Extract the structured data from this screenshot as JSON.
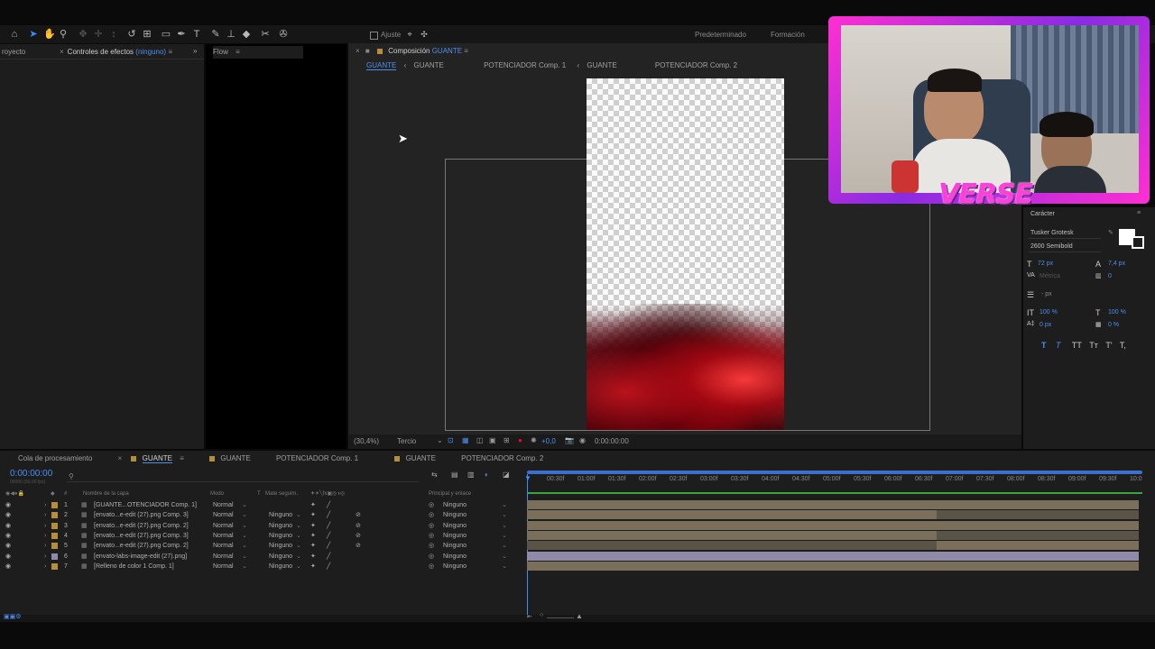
{
  "toolbar": {
    "adjust_label": "Ajuste",
    "workspaces": [
      "Predeterminado",
      "Formación"
    ]
  },
  "left_panel": {
    "project_tab": "royecto",
    "effects_tab": "Controles de efectos",
    "effects_sub": "(ninguno)",
    "flow_tab": "Flow"
  },
  "viewer": {
    "comp_label": "Composición",
    "comp_name": "GUANTE",
    "breadcrumbs": [
      "GUANTE",
      "GUANTE",
      "POTENCIADOR Comp. 1",
      "GUANTE",
      "POTENCIADOR Comp. 2"
    ],
    "zoom": "(30,4%)",
    "resolution": "Tercio",
    "exposure": "+0,0",
    "timecode": "0:00:00:00"
  },
  "char_panel": {
    "title": "Carácter",
    "font": "Tusker Grotesk",
    "style": "2600 Semibold",
    "size": "72 px",
    "leading": "7,4 px",
    "kerning": "Métrica",
    "tracking": "0",
    "stroke": "- px",
    "vscale": "100 %",
    "hscale": "100 %",
    "baseline": "0 px",
    "tsume": "0 %",
    "styles": [
      "T",
      "T",
      "TT",
      "Tт",
      "T'",
      "T,"
    ]
  },
  "webcam": {
    "overlay_text": "VERSE"
  },
  "timeline": {
    "tabs": [
      "Cola de procesamiento",
      "GUANTE",
      "GUANTE",
      "POTENCIADOR Comp. 1",
      "GUANTE",
      "POTENCIADOR Comp. 2"
    ],
    "timecode": "0:00:00:00",
    "timecode_sub": "00000 (60.00 fps)",
    "headers": {
      "num": "#",
      "name": "Nombre de la capa",
      "mode": "Modo",
      "t": "T",
      "matte": "Mate seguim.",
      "parent": "Principal y enlace"
    },
    "ruler": [
      "00:30f",
      "01:00f",
      "01:30f",
      "02:00f",
      "02:30f",
      "03:00f",
      "03:30f",
      "04:00f",
      "04:30f",
      "05:00f",
      "05:30f",
      "06:00f",
      "06:30f",
      "07:00f",
      "07:30f",
      "08:00f",
      "08:30f",
      "09:00f",
      "09:30f",
      "10:0"
    ],
    "layers": [
      {
        "num": "1",
        "name": "[GUANTE...OTENCIADOR Comp. 1]",
        "mode": "Normal",
        "matte": "",
        "parent": "Ninguno"
      },
      {
        "num": "2",
        "name": "[envato...e-edit (27).png Comp. 3]",
        "mode": "Normal",
        "matte": "Ninguno",
        "parent": "Ninguno"
      },
      {
        "num": "3",
        "name": "[envato...e-edit (27).png Comp. 2]",
        "mode": "Normal",
        "matte": "Ninguno",
        "parent": "Ninguno"
      },
      {
        "num": "4",
        "name": "[envato...e-edit (27).png Comp. 3]",
        "mode": "Normal",
        "matte": "Ninguno",
        "parent": "Ninguno"
      },
      {
        "num": "5",
        "name": "[envato...e-edit (27).png Comp. 2]",
        "mode": "Normal",
        "matte": "Ninguno",
        "parent": "Ninguno"
      },
      {
        "num": "6",
        "name": "[envato-labs-image-edit (27).png]",
        "mode": "Normal",
        "matte": "Ninguno",
        "parent": "Ninguno"
      },
      {
        "num": "7",
        "name": "[Relleno de color 1 Comp. 1]",
        "mode": "Normal",
        "matte": "Ninguno",
        "parent": "Ninguno"
      }
    ]
  },
  "colors": {
    "accent": "#4d8ff0",
    "label_tan": "#b58d3c",
    "bar_tan": "#7a6f5a",
    "bar_lavender": "#8f8aa8"
  }
}
